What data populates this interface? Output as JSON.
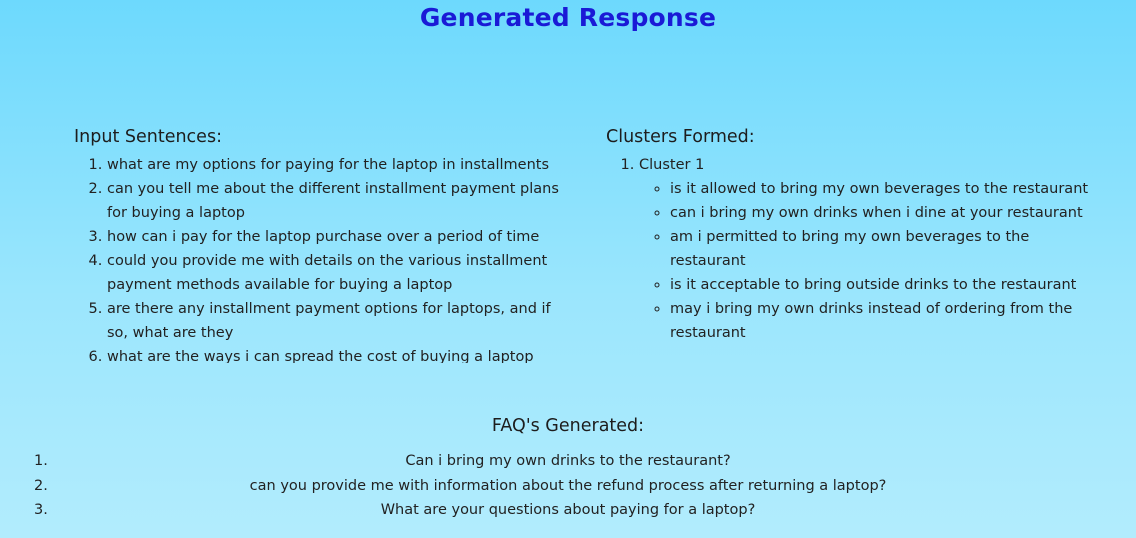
{
  "page": {
    "title": "Generated Response"
  },
  "input": {
    "heading": "Input Sentences:",
    "sentences": [
      "what are my options for paying for the laptop in installments",
      "can you tell me about the different installment payment plans for buying a laptop",
      "how can i pay for the laptop purchase over a period of time",
      "could you provide me with details on the various installment payment methods available for buying a laptop",
      "are there any installment payment options for laptops, and if so, what are they",
      "what are the ways i can spread the cost of buying a laptop"
    ]
  },
  "clusters": {
    "heading": "Clusters Formed:",
    "items": [
      {
        "label": "Cluster 1",
        "sentences": [
          "is it allowed to bring my own beverages to the restaurant",
          "can i bring my own drinks when i dine at your restaurant",
          "am i permitted to bring my own beverages to the restaurant",
          "is it acceptable to bring outside drinks to the restaurant",
          "may i bring my own drinks instead of ordering from the restaurant"
        ]
      }
    ]
  },
  "faq": {
    "heading": "FAQ's Generated:",
    "items": [
      {
        "num": "1.",
        "text": "Can i bring my own drinks to the restaurant?"
      },
      {
        "num": "2.",
        "text": "can you provide me with information about the refund process after returning a laptop?"
      },
      {
        "num": "3.",
        "text": "What are your questions about paying for a laptop?"
      }
    ]
  }
}
